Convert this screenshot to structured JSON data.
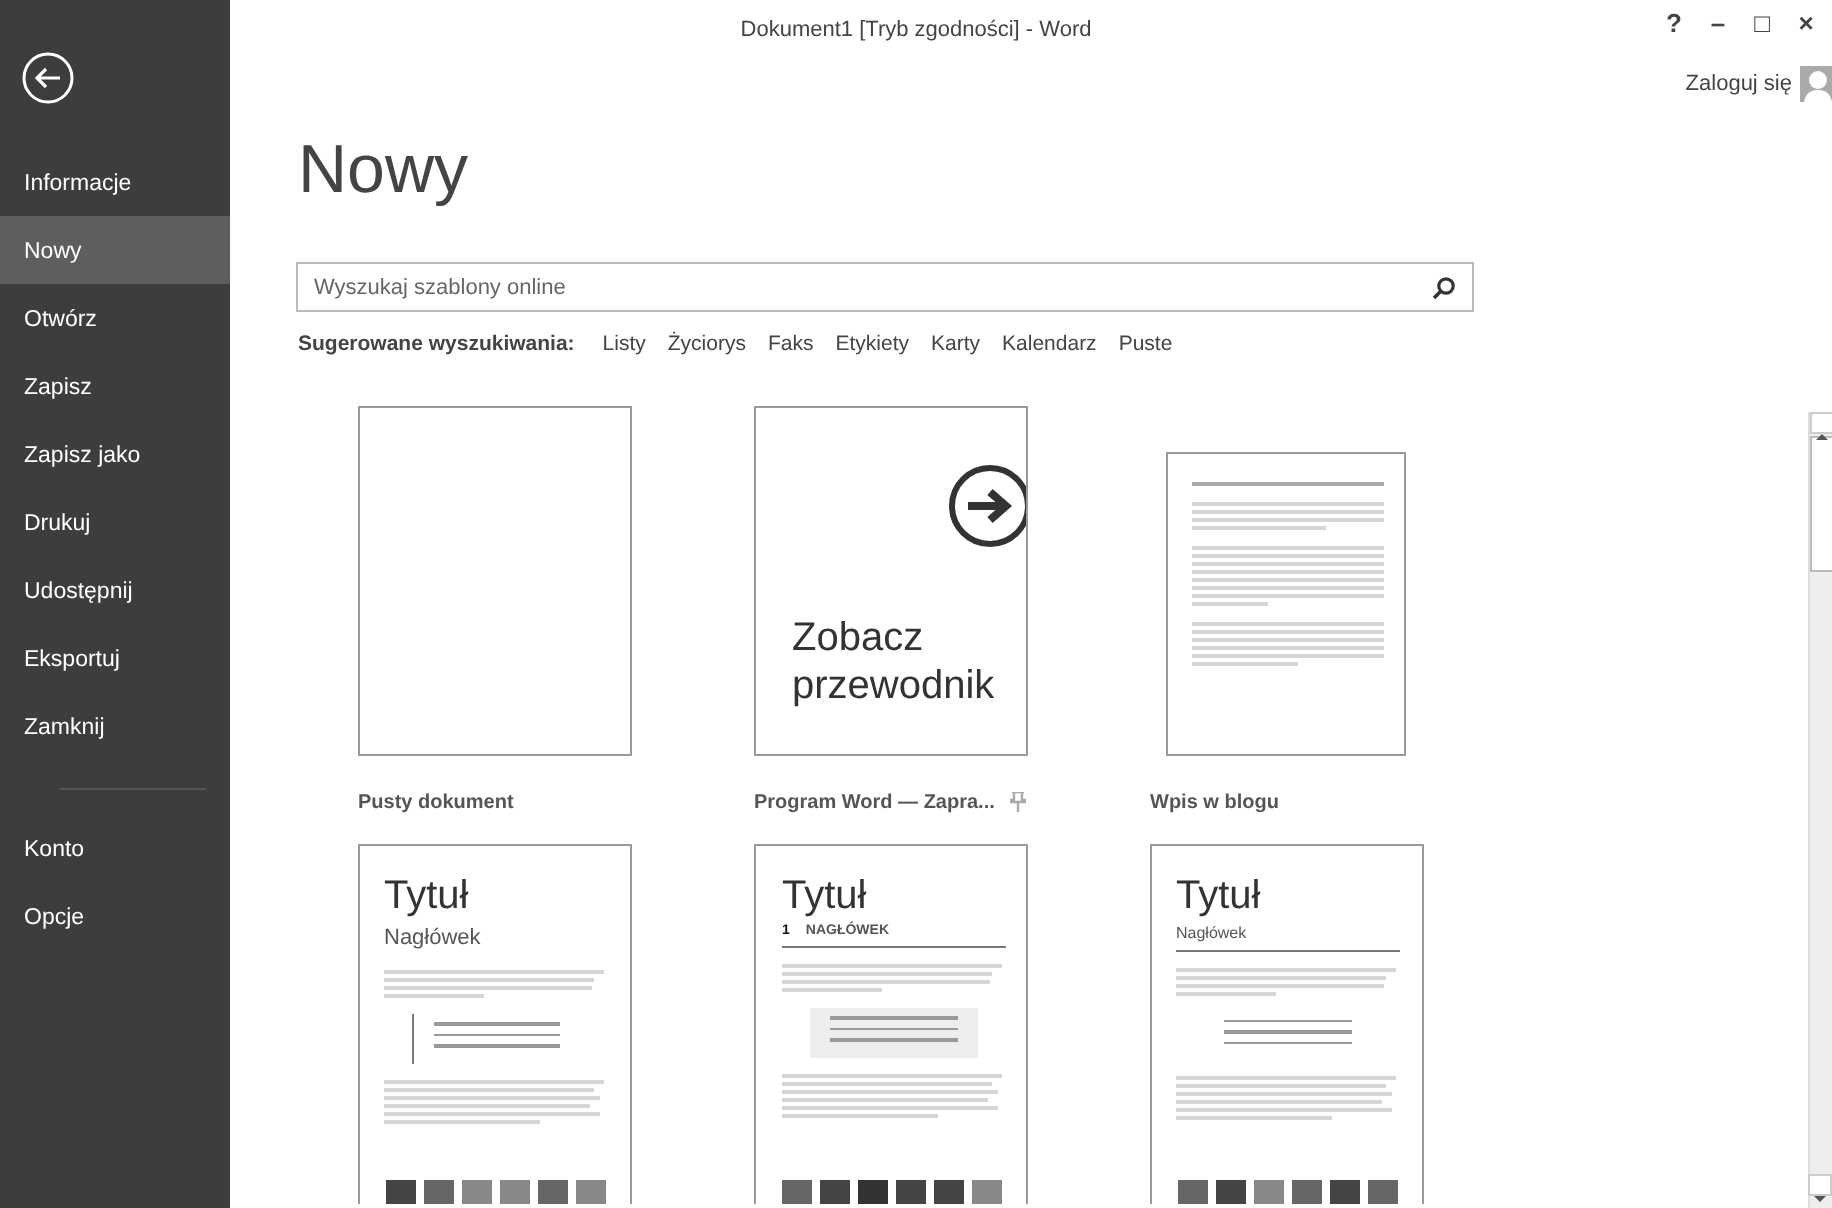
{
  "window": {
    "title": "Dokument1 [Tryb zgodności] - Word",
    "controls": [
      "?",
      "–",
      "□",
      "×"
    ],
    "sign_in": "Zaloguj się"
  },
  "sidebar": {
    "items": [
      {
        "label": "Informacje",
        "selected": false
      },
      {
        "label": "Nowy",
        "selected": true
      },
      {
        "label": "Otwórz",
        "selected": false
      },
      {
        "label": "Zapisz",
        "selected": false
      },
      {
        "label": "Zapisz jako",
        "selected": false
      },
      {
        "label": "Drukuj",
        "selected": false
      },
      {
        "label": "Udostępnij",
        "selected": false
      },
      {
        "label": "Eksportuj",
        "selected": false
      },
      {
        "label": "Zamknij",
        "selected": false
      }
    ],
    "bottom_items": [
      {
        "label": "Konto",
        "selected": false
      },
      {
        "label": "Opcje",
        "selected": false
      }
    ]
  },
  "heading": "Nowy",
  "search": {
    "placeholder": "Wyszukaj szablony online"
  },
  "suggested": {
    "label": "Sugerowane wyszukiwania:",
    "links": [
      "Listy",
      "Życiorys",
      "Faks",
      "Etykiety",
      "Karty",
      "Kalendarz",
      "Puste"
    ]
  },
  "templates": [
    {
      "kind": "blank",
      "label": "Pusty dokument",
      "pinned": false
    },
    {
      "kind": "tour",
      "label": "Program Word — Zapra...",
      "pinned": true,
      "text": "Zobacz przewodnik"
    },
    {
      "kind": "blog",
      "label": "Wpis w blogu",
      "pinned": false
    },
    {
      "kind": "report1",
      "title": "Tytuł",
      "heading": "Nagłówek"
    },
    {
      "kind": "report2",
      "title": "Tytuł",
      "number": "1",
      "heading": "NAGŁÓWEK"
    },
    {
      "kind": "report3",
      "title": "Tytuł",
      "heading": "Nagłówek"
    }
  ]
}
